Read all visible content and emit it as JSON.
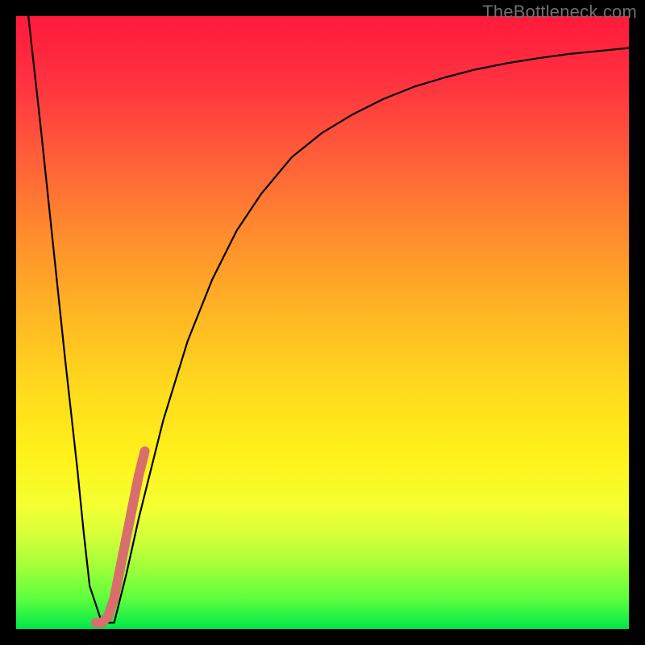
{
  "watermark": "TheBottleneck.com",
  "chart_data": {
    "type": "line",
    "title": "",
    "xlabel": "",
    "ylabel": "",
    "xlim": [
      0,
      100
    ],
    "ylim": [
      0,
      100
    ],
    "grid": false,
    "legend": false,
    "series": [
      {
        "name": "black-curve",
        "color": "#000000",
        "x": [
          2,
          4,
          6,
          8,
          10,
          11,
          12,
          14,
          16,
          18,
          20,
          24,
          28,
          32,
          36,
          40,
          45,
          50,
          55,
          60,
          65,
          70,
          75,
          80,
          85,
          90,
          95,
          100
        ],
        "values": [
          100,
          82,
          63,
          44,
          26,
          16,
          7,
          1,
          1,
          9,
          18,
          34,
          47,
          57,
          65,
          71,
          77,
          81,
          84,
          86.5,
          88.5,
          90,
          91.3,
          92.3,
          93.1,
          93.8,
          94.3,
          94.8
        ]
      },
      {
        "name": "pink-segment",
        "color": "#d86f6c",
        "x": [
          13,
          14,
          15,
          16,
          17,
          18,
          19,
          20,
          21
        ],
        "values": [
          1,
          1,
          2,
          5,
          10,
          15,
          20,
          25,
          29
        ]
      }
    ]
  }
}
